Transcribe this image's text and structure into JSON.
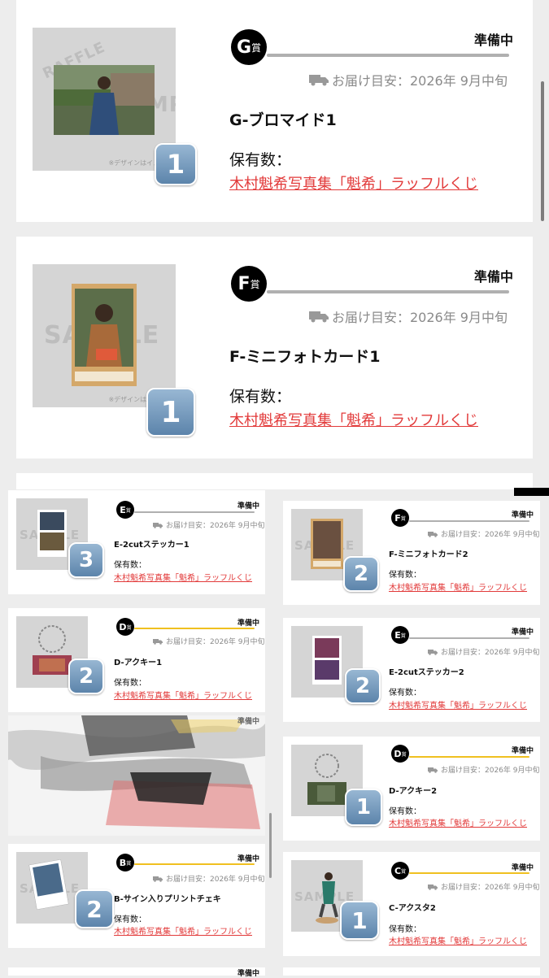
{
  "scrollbar": "visible",
  "colors": {
    "accent_red": "#e23a3a",
    "gold_line": "#f0c020",
    "gray_line": "#b0b0b0",
    "badge_blue": "#6f93b6"
  },
  "common": {
    "status": "準備中",
    "delivery": "お届け目安：2026年 9月中旬",
    "own_label": "保有数：",
    "link": "木村魁希写真集「魁希」ラッフルくじ",
    "watermark": "SAMPLE",
    "raffle_wm": "RAFFLE",
    "note": "※デザインはイメージ"
  },
  "cards": [
    {
      "prize_letter": "G",
      "prize_suffix": "賞",
      "title": "G-ブロマイド1",
      "count": "1",
      "line": "gray"
    },
    {
      "prize_letter": "F",
      "prize_suffix": "賞",
      "title": "F-ミニフォトカード1",
      "count": "1",
      "line": "gray"
    },
    {
      "prize_letter": "E",
      "prize_suffix": "賞",
      "title": "E-2cutステッカー1",
      "count": "3",
      "line": "gray"
    },
    {
      "prize_letter": "F",
      "prize_suffix": "賞",
      "title": "F-ミニフォトカード2",
      "count": "2",
      "line": "gray"
    },
    {
      "prize_letter": "D",
      "prize_suffix": "賞",
      "title": "D-アクキー1",
      "count": "2",
      "line": "gold"
    },
    {
      "prize_letter": "E",
      "prize_suffix": "賞",
      "title": "E-2cutステッカー2",
      "count": "2",
      "line": "gray"
    },
    {
      "prize_letter": "D",
      "prize_suffix": "賞",
      "title": "D-アクキー2",
      "count": "1",
      "line": "gold"
    },
    {
      "prize_letter": "B",
      "prize_suffix": "賞",
      "title": "B-サイン入りプリントチェキ",
      "count": "2",
      "line": "gold"
    },
    {
      "prize_letter": "C",
      "prize_suffix": "賞",
      "title": "C-アクスタ2",
      "count": "1",
      "line": "gold"
    }
  ],
  "partial_card": {
    "status": "準備中"
  }
}
